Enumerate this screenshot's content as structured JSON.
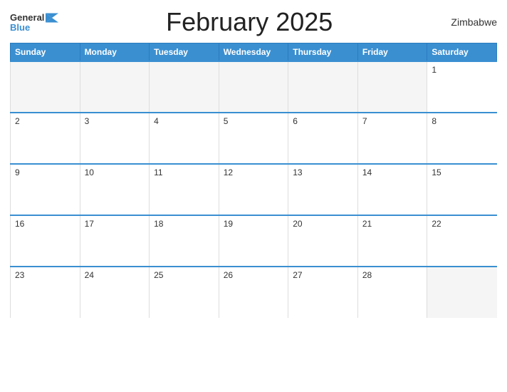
{
  "header": {
    "logo_general": "General",
    "logo_blue": "Blue",
    "title": "February 2025",
    "country": "Zimbabwe"
  },
  "days_of_week": [
    "Sunday",
    "Monday",
    "Tuesday",
    "Wednesday",
    "Thursday",
    "Friday",
    "Saturday"
  ],
  "weeks": [
    [
      null,
      null,
      null,
      null,
      null,
      null,
      1
    ],
    [
      2,
      3,
      4,
      5,
      6,
      7,
      8
    ],
    [
      9,
      10,
      11,
      12,
      13,
      14,
      15
    ],
    [
      16,
      17,
      18,
      19,
      20,
      21,
      22
    ],
    [
      23,
      24,
      25,
      26,
      27,
      28,
      null
    ]
  ]
}
